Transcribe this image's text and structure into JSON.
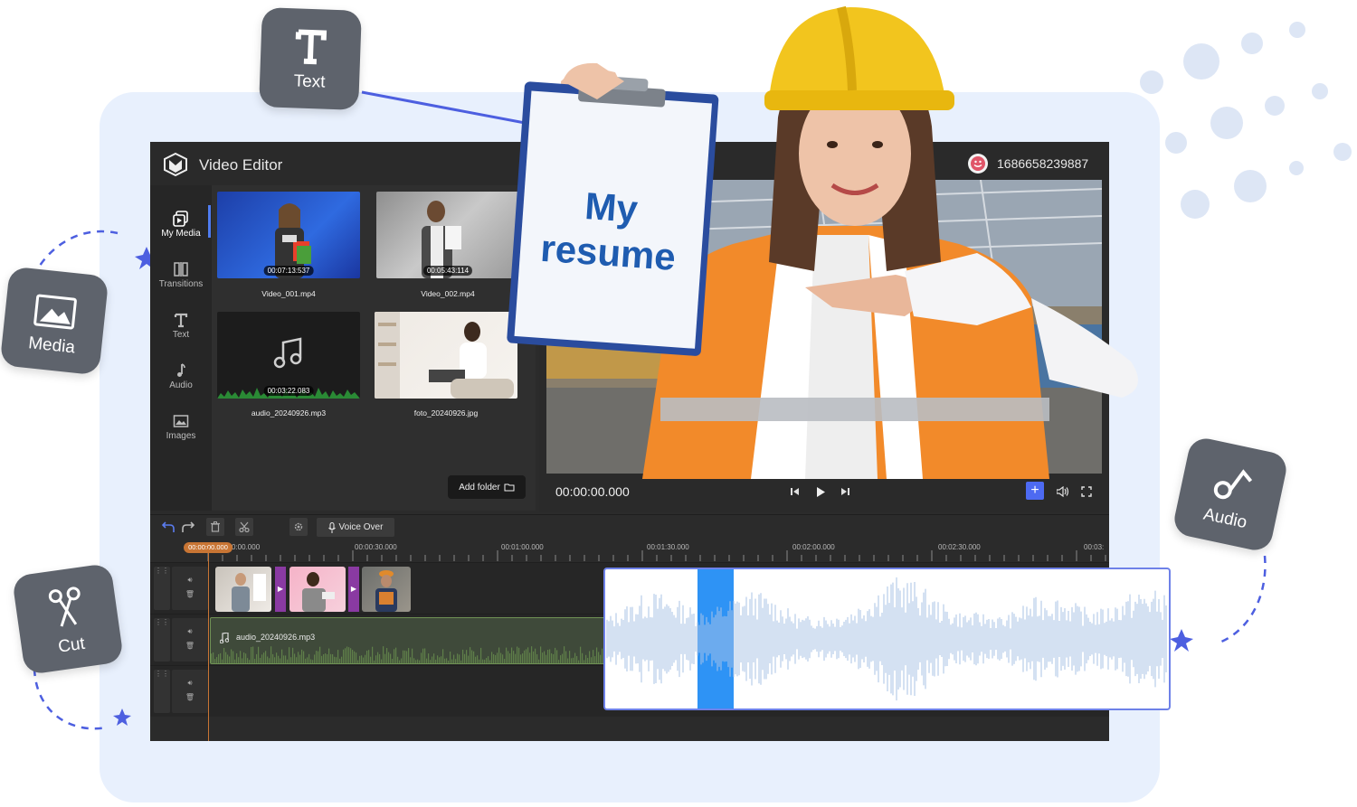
{
  "app": {
    "title": "Video Editor",
    "user_id": "1686658239887"
  },
  "sidebar": {
    "items": [
      {
        "label": "My Media",
        "icon": "media-library-icon",
        "active": true
      },
      {
        "label": "Transitions",
        "icon": "transitions-icon",
        "active": false
      },
      {
        "label": "Text",
        "icon": "text-icon",
        "active": false
      },
      {
        "label": "Audio",
        "icon": "music-note-icon",
        "active": false
      },
      {
        "label": "Images",
        "icon": "image-icon",
        "active": false
      }
    ]
  },
  "media": {
    "items": [
      {
        "name": "Video_001.mp4",
        "duration": "00:07:13:537"
      },
      {
        "name": "Video_002.mp4",
        "duration": "00:05:43:114"
      },
      {
        "name": "audio_20240926.mp3",
        "duration": "00:03:22.083"
      },
      {
        "name": "foto_20240926.jpg",
        "duration": ""
      }
    ],
    "add_folder_label": "Add folder"
  },
  "preview": {
    "time": "00:00:00.000",
    "sign_text_line1": "My",
    "sign_text_line2": "resume"
  },
  "timeline": {
    "voice_over_label": "Voice Over",
    "playhead_time": "00:00:00.000",
    "ruler_labels": [
      "0:00.000",
      "00:00:30.000",
      "00:01:00.000",
      "00:01:30.000",
      "00:02:00.000",
      "00:02:30.000",
      "00:03:"
    ],
    "audio_clip_name": "audio_20240926.mp3"
  },
  "badges": {
    "text": "Text",
    "media": "Media",
    "cut": "Cut",
    "audio": "Audio"
  },
  "colors": {
    "accent": "#4d6af2",
    "playhead": "#c87534",
    "badge": "#5e636c",
    "card_bg": "#e8f0fd",
    "waveform": "#a9c3e6",
    "waveform_highlight": "#2e93f5"
  }
}
